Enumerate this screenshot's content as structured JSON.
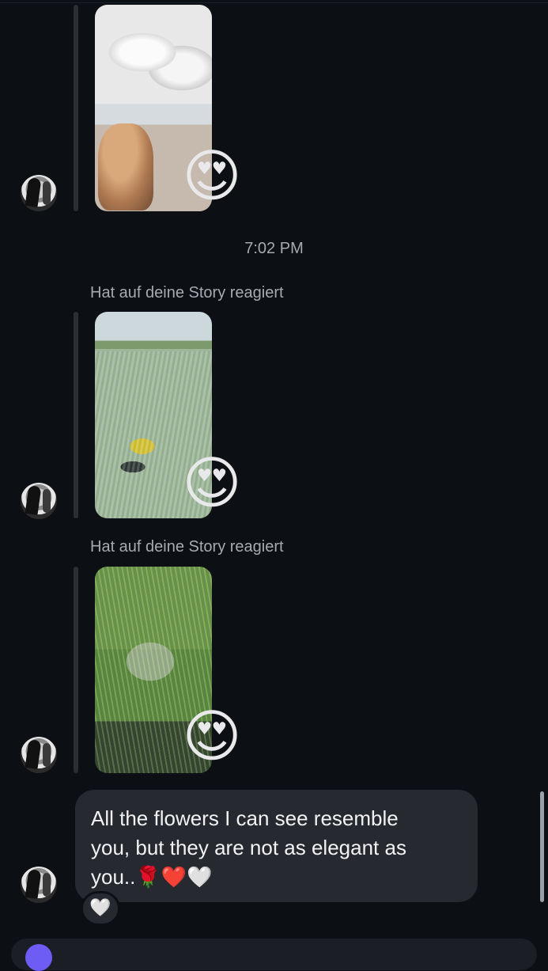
{
  "timestamp": "7:02 PM",
  "story_reply_label": "Hat auf deine Story reagiert",
  "messages": [
    {
      "type": "story_reaction",
      "reaction": "😍"
    },
    {
      "type": "story_reaction",
      "label": "Hat auf deine Story reagiert",
      "reaction": "😍"
    },
    {
      "type": "story_reaction",
      "label": "Hat auf deine Story reagiert",
      "reaction": "😍"
    }
  ],
  "text_message": {
    "line1": "All the flowers I can see resemble",
    "line2": "you, but they are not as elegant as",
    "line3": "you..",
    "emojis": "🌹❤️🤍",
    "reaction": "🤍"
  },
  "colors": {
    "background": "#0c0f14",
    "bubble": "#26292f",
    "meta_text": "#a8aab0",
    "accent": "#6d5df5"
  },
  "icons": [
    "avatar",
    "heart-eyes-emoji",
    "white-heart-icon"
  ]
}
